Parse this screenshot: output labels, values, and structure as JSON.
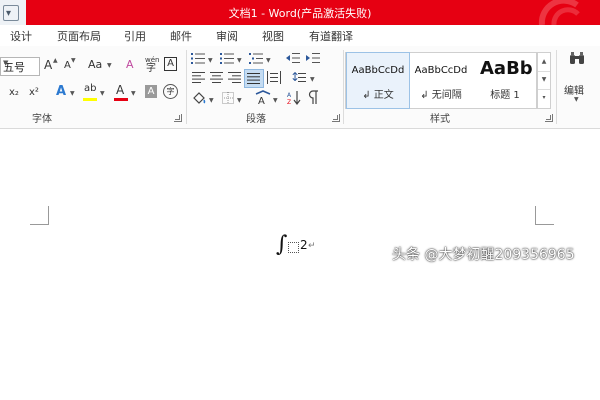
{
  "window": {
    "title": "文档1 - Word(产品激活失败)"
  },
  "tabs": [
    {
      "label": "设计"
    },
    {
      "label": "页面布局"
    },
    {
      "label": "引用"
    },
    {
      "label": "邮件"
    },
    {
      "label": "审阅"
    },
    {
      "label": "视图"
    },
    {
      "label": "有道翻译"
    }
  ],
  "ribbon": {
    "font_group": {
      "label": "字体",
      "font_size": "五号",
      "grow_glyph": "A",
      "shrink_glyph": "A",
      "case_glyph": "Aa",
      "clear_glyph": "A",
      "phonetic_top": "wén",
      "phonetic_bottom": "字",
      "border_glyph": "A",
      "subscript_glyph": "x₂",
      "superscript_glyph": "x²",
      "effects_glyph": "A",
      "highlight_glyph": "ab",
      "color_glyph": "A",
      "shade_glyph": "A",
      "enclose_glyph": "字"
    },
    "paragraph_group": {
      "label": "段落"
    },
    "styles_group": {
      "label": "样式",
      "items": [
        {
          "preview": "AaBbCcDd",
          "name": "↲ 正文"
        },
        {
          "preview": "AaBbCcDd",
          "name": "↲ 无间隔"
        },
        {
          "preview": "AaBb",
          "name": "标题 1"
        }
      ]
    },
    "editing": {
      "label": "编辑"
    }
  },
  "document": {
    "formula": {
      "integral": "∫",
      "number": "2"
    }
  },
  "watermark": "头条 @大梦初醒209356965",
  "colors": {
    "titlebar": "#e60012",
    "accent": "#2b579a",
    "font_color": "#e60012",
    "highlight": "#ffff00"
  }
}
